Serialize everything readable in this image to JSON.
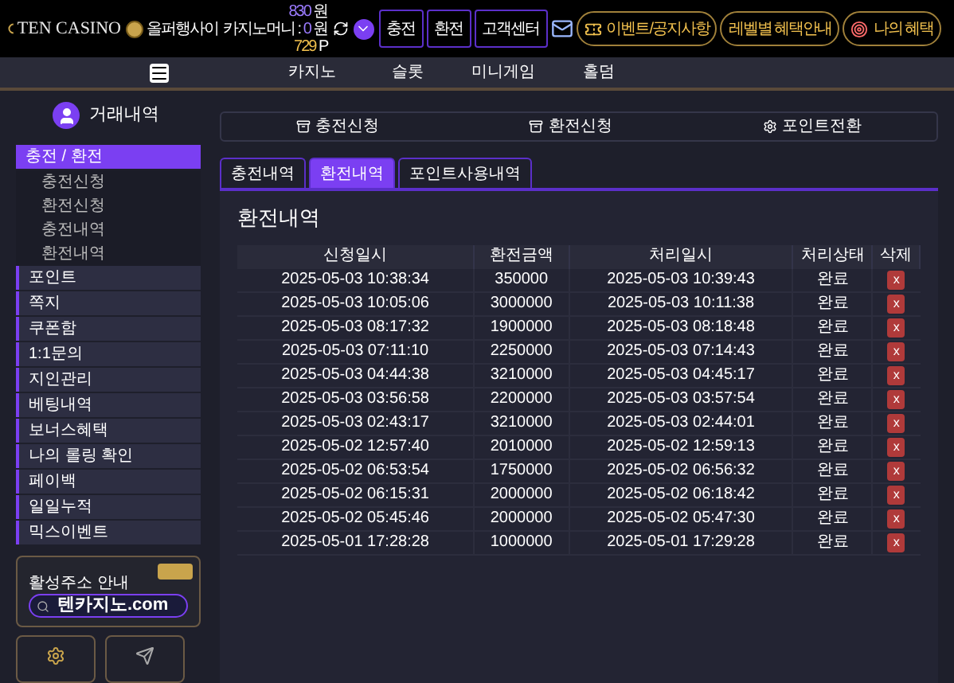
{
  "header": {
    "logo": "TEN CASINO",
    "user_name": "올퍼행사이",
    "balance": "830",
    "balance_unit": "원",
    "casino_money_label": "카지노머니 :",
    "casino_money": "0",
    "casino_money_unit": "원",
    "points": "729",
    "points_unit": "P",
    "buttons": [
      {
        "kind": "box",
        "label": "충전"
      },
      {
        "kind": "box",
        "label": "환전"
      },
      {
        "kind": "box",
        "label": "고객센터"
      },
      {
        "kind": "mail"
      },
      {
        "kind": "event",
        "label": "이벤트/공지사항"
      },
      {
        "kind": "plain",
        "label": "레벨별 혜택안내"
      },
      {
        "kind": "benefit",
        "label": "나의 혜택"
      }
    ]
  },
  "nav": {
    "items": [
      "카지노",
      "슬롯",
      "미니게임",
      "홀덤"
    ]
  },
  "sidebar": {
    "title": "거래내역",
    "items": [
      {
        "label": "충전 / 환전",
        "selected": true,
        "children": [
          {
            "label": "충전신청"
          },
          {
            "label": "환전신청"
          },
          {
            "label": "충전내역"
          },
          {
            "label": "환전내역"
          }
        ]
      },
      {
        "label": "포인트",
        "selected": false
      },
      {
        "label": "쪽지",
        "selected": false
      },
      {
        "label": "쿠폰함",
        "selected": false
      },
      {
        "label": "1:1문의",
        "selected": false
      },
      {
        "label": "지인관리",
        "selected": false
      },
      {
        "label": "베팅내역",
        "selected": false
      },
      {
        "label": "보너스혜택",
        "selected": false
      },
      {
        "label": "나의 롤링 확인",
        "selected": false
      },
      {
        "label": "페이백",
        "selected": false
      },
      {
        "label": "일일누적",
        "selected": false
      },
      {
        "label": "믹스이벤트",
        "selected": false
      }
    ],
    "banner": {
      "caption": "활성주소 안내",
      "address": "텐카지노.com"
    }
  },
  "actions": [
    {
      "kind": "request",
      "label": "충전신청"
    },
    {
      "kind": "request",
      "label": "환전신청"
    },
    {
      "kind": "convert",
      "label": "포인트전환"
    }
  ],
  "tabs": [
    {
      "label": "충전내역",
      "selected": false
    },
    {
      "label": "환전내역",
      "selected": true
    },
    {
      "label": "포인트사용내역",
      "selected": false
    }
  ],
  "panel_title": "환전내역",
  "table": {
    "columns": [
      "신청일시",
      "환전금액",
      "처리일시",
      "처리상태",
      "삭제"
    ],
    "rows": [
      {
        "requested": "2025-05-03 10:38:34",
        "amount": "350000",
        "processed": "2025-05-03 10:39:43",
        "status": "완료",
        "delete": "x"
      },
      {
        "requested": "2025-05-03 10:05:06",
        "amount": "3000000",
        "processed": "2025-05-03 10:11:38",
        "status": "완료",
        "delete": "x"
      },
      {
        "requested": "2025-05-03 08:17:32",
        "amount": "1900000",
        "processed": "2025-05-03 08:18:48",
        "status": "완료",
        "delete": "x"
      },
      {
        "requested": "2025-05-03 07:11:10",
        "amount": "2250000",
        "processed": "2025-05-03 07:14:43",
        "status": "완료",
        "delete": "x"
      },
      {
        "requested": "2025-05-03 04:44:38",
        "amount": "3210000",
        "processed": "2025-05-03 04:45:17",
        "status": "완료",
        "delete": "x"
      },
      {
        "requested": "2025-05-03 03:56:58",
        "amount": "2200000",
        "processed": "2025-05-03 03:57:54",
        "status": "완료",
        "delete": "x"
      },
      {
        "requested": "2025-05-03 02:43:17",
        "amount": "3210000",
        "processed": "2025-05-03 02:44:01",
        "status": "완료",
        "delete": "x"
      },
      {
        "requested": "2025-05-02 12:57:40",
        "amount": "2010000",
        "processed": "2025-05-02 12:59:13",
        "status": "완료",
        "delete": "x"
      },
      {
        "requested": "2025-05-02 06:53:54",
        "amount": "1750000",
        "processed": "2025-05-02 06:56:32",
        "status": "완료",
        "delete": "x"
      },
      {
        "requested": "2025-05-02 06:15:31",
        "amount": "2000000",
        "processed": "2025-05-02 06:18:42",
        "status": "완료",
        "delete": "x"
      },
      {
        "requested": "2025-05-02 05:45:46",
        "amount": "2000000",
        "processed": "2025-05-02 05:47:30",
        "status": "완료",
        "delete": "x"
      },
      {
        "requested": "2025-05-01 17:28:28",
        "amount": "1000000",
        "processed": "2025-05-01 17:29:28",
        "status": "완료",
        "delete": "x"
      }
    ]
  }
}
